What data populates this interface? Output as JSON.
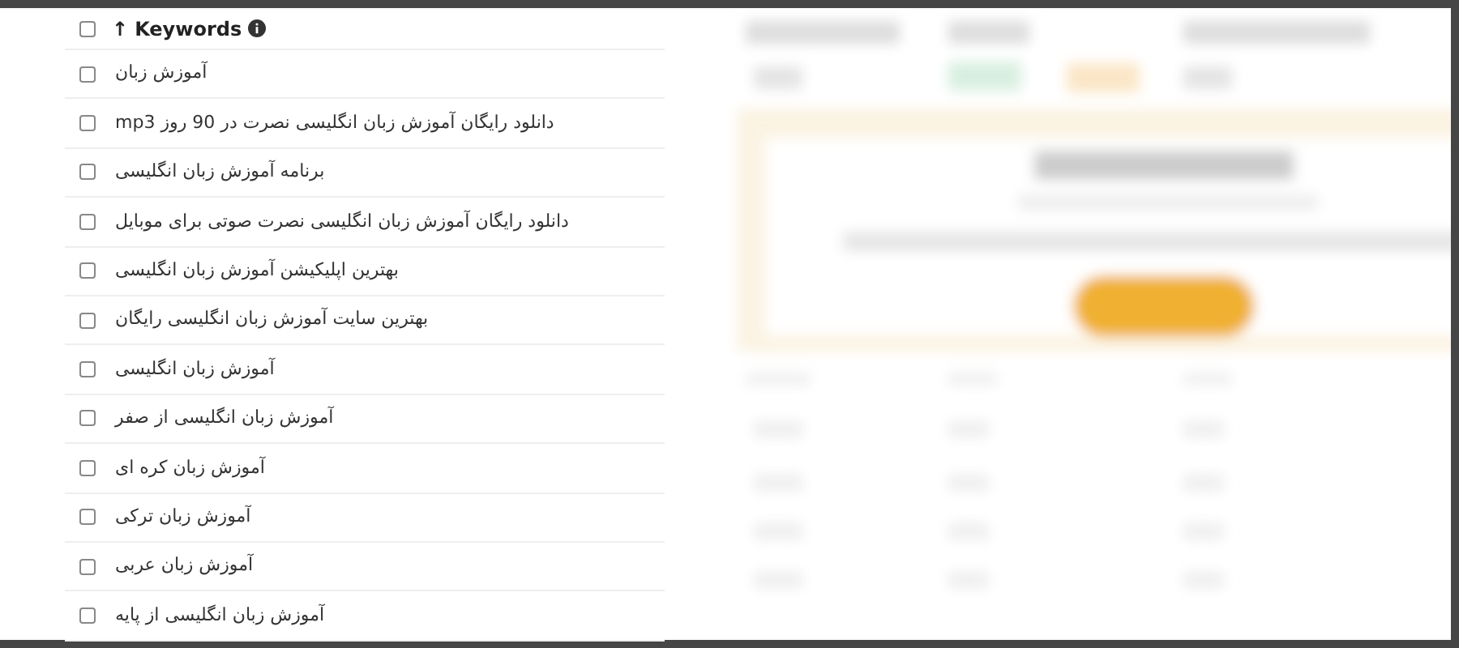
{
  "table": {
    "header": {
      "label": "Keywords",
      "sort_arrow": "↑",
      "checked": false
    },
    "rows": [
      {
        "keyword": "آموزش زبان",
        "checked": false
      },
      {
        "keyword": "دانلود رایگان آموزش زبان انگلیسی نصرت در 90 روز mp3",
        "checked": false
      },
      {
        "keyword": "برنامه آموزش زبان انگلیسی",
        "checked": false
      },
      {
        "keyword": "دانلود رایگان آموزش زبان انگلیسی نصرت صوتی برای موبایل",
        "checked": false
      },
      {
        "keyword": "بهترین اپلیکیشن آموزش زبان انگلیسی",
        "checked": false
      },
      {
        "keyword": "بهترین سایت آموزش زبان انگلیسی رایگان",
        "checked": false
      },
      {
        "keyword": "آموزش زبان انگلیسی",
        "checked": false
      },
      {
        "keyword": "آموزش زبان انگلیسی از صفر",
        "checked": false
      },
      {
        "keyword": "آموزش زبان کره ای",
        "checked": false
      },
      {
        "keyword": "آموزش زبان ترکی",
        "checked": false
      },
      {
        "keyword": "آموزش زبان عربی",
        "checked": false
      },
      {
        "keyword": "آموزش زبان انگلیسی از پایه",
        "checked": false
      }
    ]
  }
}
